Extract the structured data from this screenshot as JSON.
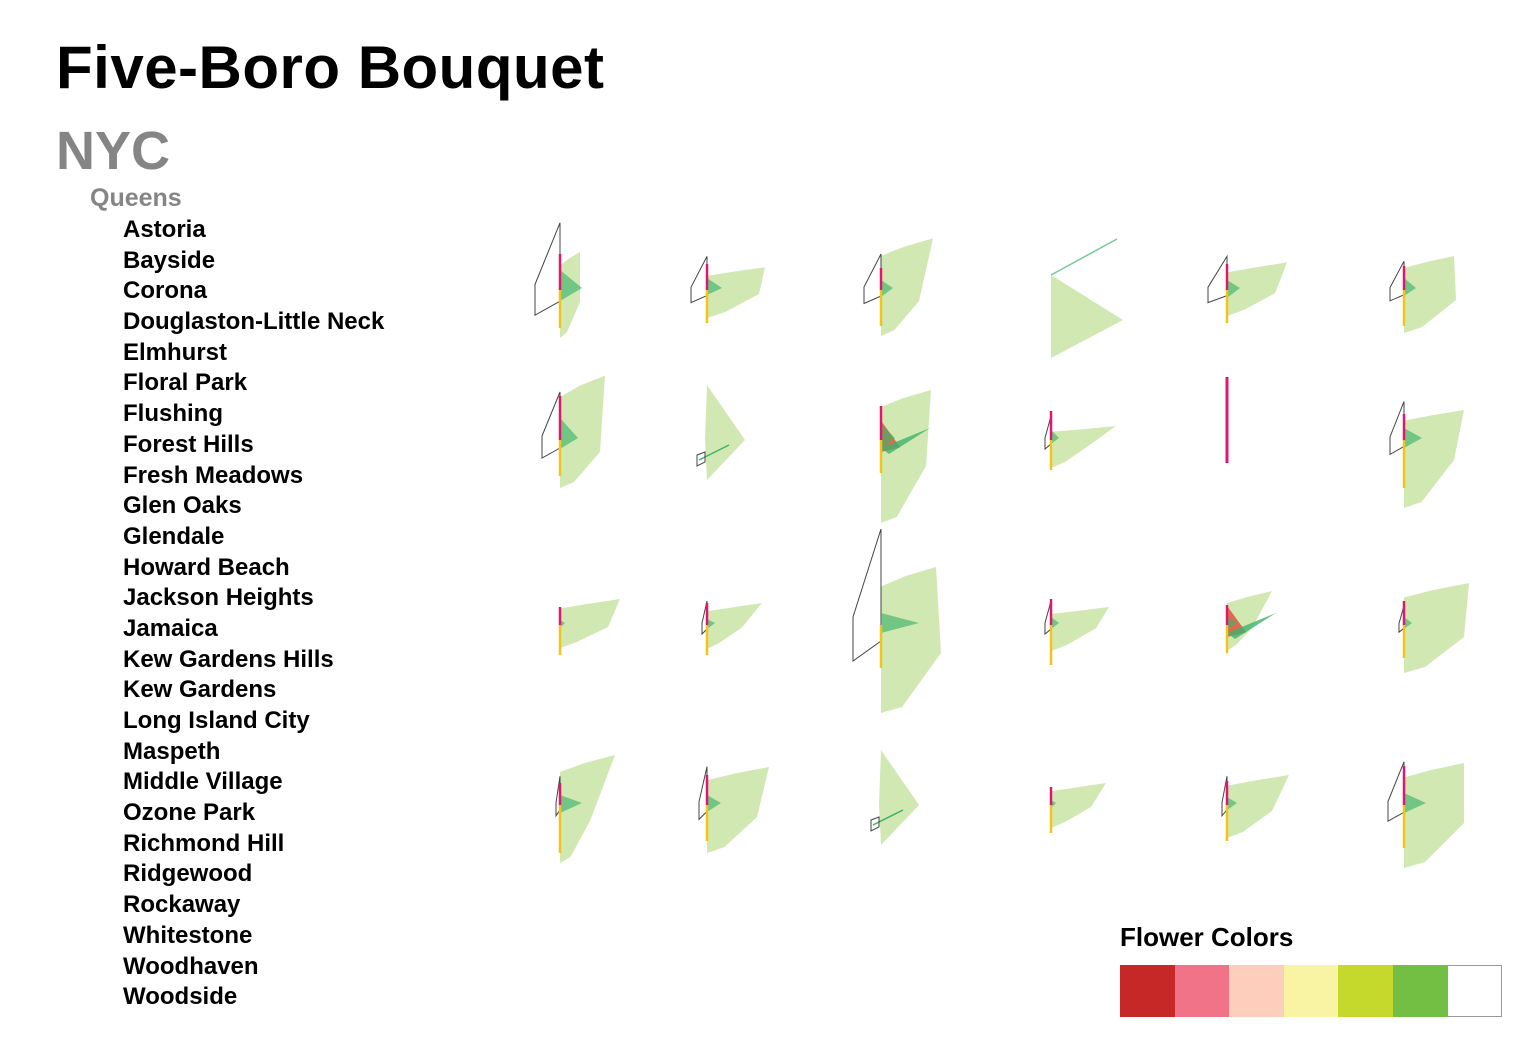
{
  "chart_data": {
    "type": "glyph-grid",
    "title": "Five-Boro Bouquet",
    "city": "NYC",
    "borough": "Queens",
    "neighborhoods": [
      "Astoria",
      "Bayside",
      "Corona",
      "Douglaston-Little Neck",
      "Elmhurst",
      "Floral Park",
      "Flushing",
      "Forest Hills",
      "Fresh Meadows",
      "Glen Oaks",
      "Glendale",
      "Howard Beach",
      "Jackson Heights",
      "Jamaica",
      "Kew Gardens Hills",
      "Kew Gardens",
      "Long Island City",
      "Maspeth",
      "Middle Village",
      "Ozone Park",
      "Richmond Hill",
      "Ridgewood",
      "Rockaway",
      "Whitestone",
      "Woodhaven",
      "Woodside"
    ],
    "grid": {
      "rows": 4,
      "cols": 6
    },
    "legend": {
      "title": "Flower Colors",
      "colors": [
        "#c62828",
        "#f07388",
        "#fdcebc",
        "#f9f4a4",
        "#c5d92d",
        "#72bf44",
        "#ffffff"
      ]
    },
    "glyph_colors": {
      "leaf": "#c9e4a6",
      "petal": "#3db36b",
      "red": "#e0402e",
      "stem_yellow": "#f2c318",
      "stem_pink": "#e0176f",
      "outline": "#444444"
    },
    "glyphs": [
      {
        "leaf": [
          20,
          45,
          20,
          30
        ],
        "petal": [
          22,
          11,
          20
        ],
        "red": 0,
        "outline": [
          25,
          28
        ],
        "pink": 22,
        "yellow": 20,
        "spike": 0
      },
      {
        "leaf": [
          58,
          26,
          52,
          10
        ],
        "petal": [
          15,
          5,
          12
        ],
        "red": 0,
        "outline": [
          16,
          14
        ],
        "pink": 12,
        "yellow": 15,
        "spike": 0
      },
      {
        "leaf": [
          52,
          62,
          38,
          28
        ],
        "petal": [
          12,
          7,
          10
        ],
        "red": 0,
        "outline": [
          17,
          15
        ],
        "pink": 8,
        "yellow": 18,
        "spike": 0
      },
      {
        "leaf": [
          0,
          0,
          0,
          0
        ],
        "petal": [
          0,
          0,
          0
        ],
        "red": 0,
        "outline": [
          0,
          0
        ],
        "pink": 0,
        "yellow": 0,
        "spike": 0,
        "special": "line-tri"
      },
      {
        "leaf": [
          60,
          32,
          48,
          8
        ],
        "petal": [
          13,
          8,
          10
        ],
        "red": 0,
        "outline": [
          19,
          14
        ],
        "pink": 12,
        "yellow": 15,
        "spike": 0
      },
      {
        "leaf": [
          50,
          40,
          52,
          25
        ],
        "petal": [
          12,
          6,
          12
        ],
        "red": 0,
        "outline": [
          14,
          12
        ],
        "pink": 10,
        "yellow": 18,
        "spike": 0
      },
      {
        "leaf": [
          45,
          78,
          40,
          30
        ],
        "petal": [
          18,
          9,
          22
        ],
        "red": 0,
        "outline": [
          18,
          20
        ],
        "pink": 30,
        "yellow": 18,
        "spike": 0
      },
      {
        "leaf": [
          0,
          0,
          0,
          0
        ],
        "petal": [
          0,
          0,
          0
        ],
        "red": 0,
        "outline": [
          0,
          0
        ],
        "pink": 0,
        "yellow": 0,
        "spike": 0,
        "special": "kite-small"
      },
      {
        "leaf": [
          50,
          60,
          45,
          65
        ],
        "petal": [
          14,
          10,
          16
        ],
        "red": 12,
        "outline": [
          0,
          0
        ],
        "pink": 20,
        "yellow": 15,
        "spike": 35
      },
      {
        "leaf": [
          65,
          15,
          40,
          10
        ],
        "petal": [
          8,
          4,
          10
        ],
        "red": 0,
        "outline": [
          6,
          10
        ],
        "pink": 15,
        "yellow": 12,
        "spike": 0
      },
      {
        "leaf": [
          0,
          0,
          0,
          0
        ],
        "petal": [
          0,
          0,
          0
        ],
        "red": 0,
        "outline": [
          0,
          0
        ],
        "pink": 0,
        "yellow": 0,
        "spike": 0,
        "special": "pink-only"
      },
      {
        "leaf": [
          60,
          35,
          50,
          50
        ],
        "petal": [
          18,
          8,
          12
        ],
        "red": 0,
        "outline": [
          14,
          16
        ],
        "pink": 12,
        "yellow": 30,
        "spike": 0
      },
      {
        "leaf": [
          60,
          30,
          48,
          5
        ],
        "petal": [
          5,
          3,
          5
        ],
        "red": 0,
        "outline": [
          0,
          0
        ],
        "pink": 4,
        "yellow": 12,
        "spike": 0
      },
      {
        "leaf": [
          55,
          25,
          35,
          6
        ],
        "petal": [
          8,
          4,
          6
        ],
        "red": 0,
        "outline": [
          5,
          10
        ],
        "pink": 8,
        "yellow": 12,
        "spike": 0
      },
      {
        "leaf": [
          55,
          70,
          60,
          70
        ],
        "petal": [
          38,
          8,
          12
        ],
        "red": 0,
        "outline": [
          28,
          40
        ],
        "pink": 0,
        "yellow": 25,
        "spike": 0
      },
      {
        "leaf": [
          58,
          20,
          45,
          8
        ],
        "petal": [
          8,
          4,
          8
        ],
        "red": 0,
        "outline": [
          6,
          10
        ],
        "pink": 12,
        "yellow": 22,
        "spike": 0
      },
      {
        "leaf": [
          45,
          40,
          25,
          8
        ],
        "petal": [
          10,
          5,
          8
        ],
        "red": 12,
        "outline": [
          0,
          0
        ],
        "pink": 6,
        "yellow": 10,
        "spike": 35
      },
      {
        "leaf": [
          65,
          50,
          60,
          30
        ],
        "petal": [
          8,
          4,
          8
        ],
        "red": 0,
        "outline": [
          5,
          8
        ],
        "pink": 10,
        "yellow": 15,
        "spike": 0
      },
      {
        "leaf": [
          55,
          60,
          30,
          40
        ],
        "petal": [
          22,
          8,
          10
        ],
        "red": 0,
        "outline": [
          4,
          12
        ],
        "pink": 8,
        "yellow": 30,
        "spike": 0
      },
      {
        "leaf": [
          62,
          45,
          50,
          30
        ],
        "petal": [
          14,
          7,
          10
        ],
        "red": 0,
        "outline": [
          8,
          16
        ],
        "pink": 16,
        "yellow": 18,
        "spike": 0
      },
      {
        "leaf": [
          0,
          0,
          0,
          0
        ],
        "petal": [
          0,
          0,
          0
        ],
        "red": 0,
        "outline": [
          0,
          0
        ],
        "pink": 0,
        "yellow": 0,
        "spike": 0,
        "special": "kite-small-2"
      },
      {
        "leaf": [
          55,
          25,
          40,
          5
        ],
        "petal": [
          5,
          3,
          5
        ],
        "red": 0,
        "outline": [
          0,
          0
        ],
        "pink": 4,
        "yellow": 10,
        "spike": 0
      },
      {
        "leaf": [
          62,
          35,
          45,
          15
        ],
        "petal": [
          10,
          5,
          8
        ],
        "red": 0,
        "outline": [
          5,
          12
        ],
        "pink": 10,
        "yellow": 18,
        "spike": 0
      },
      {
        "leaf": [
          60,
          50,
          60,
          45
        ],
        "petal": [
          22,
          8,
          12
        ],
        "red": 0,
        "outline": [
          16,
          18
        ],
        "pink": 25,
        "yellow": 25,
        "spike": 0
      }
    ]
  }
}
